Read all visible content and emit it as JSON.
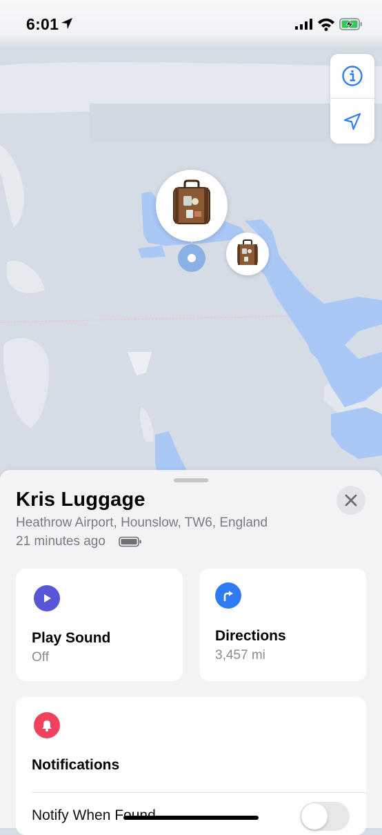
{
  "status_bar": {
    "time": "6:01",
    "icons": [
      "location-arrow-icon",
      "cell-signal-icon",
      "wifi-icon",
      "battery-charging-icon"
    ]
  },
  "map": {
    "controls": [
      "info-icon",
      "location-arrow-icon"
    ],
    "pins": [
      "suitcase-pin",
      "suitcase-pin-small"
    ]
  },
  "item": {
    "name": "Kris Luggage",
    "address": "Heathrow Airport, Hounslow, TW6, England",
    "updated": "21 minutes ago"
  },
  "actions": {
    "play_sound": {
      "label": "Play Sound",
      "status": "Off"
    },
    "directions": {
      "label": "Directions",
      "distance": "3,457 mi"
    }
  },
  "notifications": {
    "title": "Notifications",
    "notify_when_found": "Notify When Found",
    "notify_when_found_enabled": false
  },
  "colors": {
    "accent_blue": "#2f7bf6",
    "play_sound_purple": "#5856d6",
    "notifications_red": "#f0425c",
    "map_terminal_blue": "#a9c8f5"
  }
}
